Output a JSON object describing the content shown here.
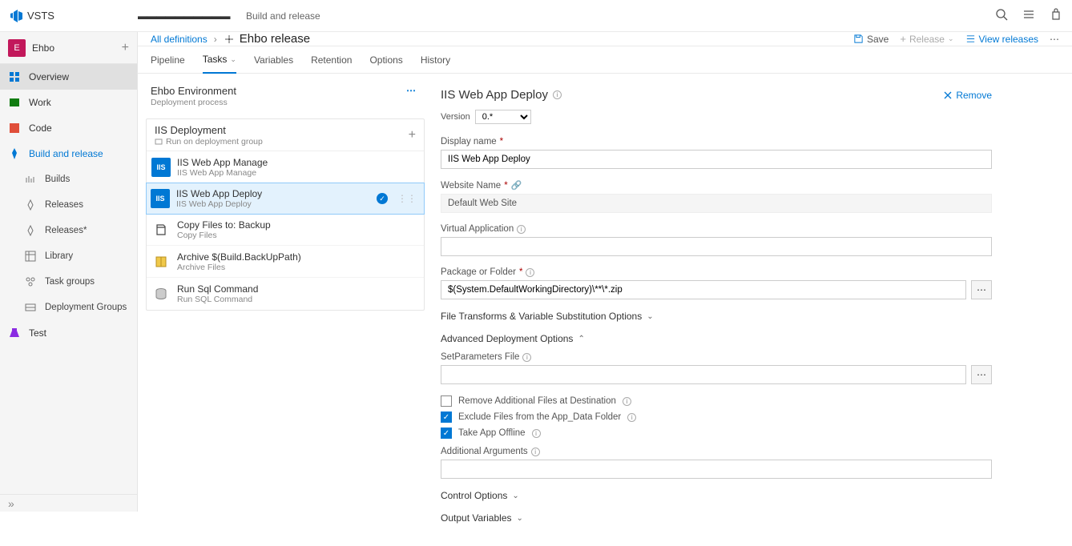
{
  "topbar": {
    "product": "VSTS",
    "org": "▬▬▬▬▬▬▬▬▬▬",
    "section": "Build and release"
  },
  "sidebar": {
    "project_letter": "E",
    "project_name": "Ehbo",
    "items": [
      {
        "label": "Overview"
      },
      {
        "label": "Work"
      },
      {
        "label": "Code"
      },
      {
        "label": "Build and release"
      },
      {
        "label": "Builds",
        "sub": true
      },
      {
        "label": "Releases",
        "sub": true
      },
      {
        "label": "Releases*",
        "sub": true
      },
      {
        "label": "Library",
        "sub": true
      },
      {
        "label": "Task groups",
        "sub": true
      },
      {
        "label": "Deployment Groups",
        "sub": true
      },
      {
        "label": "Test"
      }
    ]
  },
  "breadcrumb": {
    "all": "All definitions",
    "title": "Ehbo release"
  },
  "toolbar": {
    "save": "Save",
    "release": "Release",
    "view": "View releases"
  },
  "tabs": [
    "Pipeline",
    "Tasks",
    "Variables",
    "Retention",
    "Options",
    "History"
  ],
  "env": {
    "name": "Ehbo Environment",
    "sub": "Deployment process"
  },
  "phase": {
    "name": "IIS Deployment",
    "sub": "Run on deployment group"
  },
  "tasks": [
    {
      "icon": "iis",
      "title": "IIS Web App Manage",
      "sub": "IIS Web App Manage"
    },
    {
      "icon": "iis",
      "title": "IIS Web App Deploy",
      "sub": "IIS Web App Deploy",
      "selected": true,
      "check": true
    },
    {
      "icon": "copy",
      "title": "Copy Files to: Backup",
      "sub": "Copy Files"
    },
    {
      "icon": "archive",
      "title": "Archive $(Build.BackUpPath)",
      "sub": "Archive Files"
    },
    {
      "icon": "sql",
      "title": "Run Sql Command",
      "sub": "Run SQL Command"
    }
  ],
  "detail": {
    "title": "IIS Web App Deploy",
    "remove": "Remove",
    "version_label": "Version",
    "version_value": "0.*",
    "display_name_label": "Display name",
    "display_name_value": "IIS Web App Deploy",
    "website_label": "Website Name",
    "website_value": "Default Web Site",
    "virtual_label": "Virtual Application",
    "virtual_value": "",
    "package_label": "Package or Folder",
    "package_value": "$(System.DefaultWorkingDirectory)\\**\\*.zip",
    "section_filetrans": "File Transforms & Variable Substitution Options",
    "section_adv": "Advanced Deployment Options",
    "setparam_label": "SetParameters File",
    "setparam_value": "",
    "chk_remove": "Remove Additional Files at Destination",
    "chk_exclude": "Exclude Files from the App_Data Folder",
    "chk_offline": "Take App Offline",
    "addargs_label": "Additional Arguments",
    "addargs_value": "",
    "section_ctrl": "Control Options",
    "section_out": "Output Variables"
  }
}
